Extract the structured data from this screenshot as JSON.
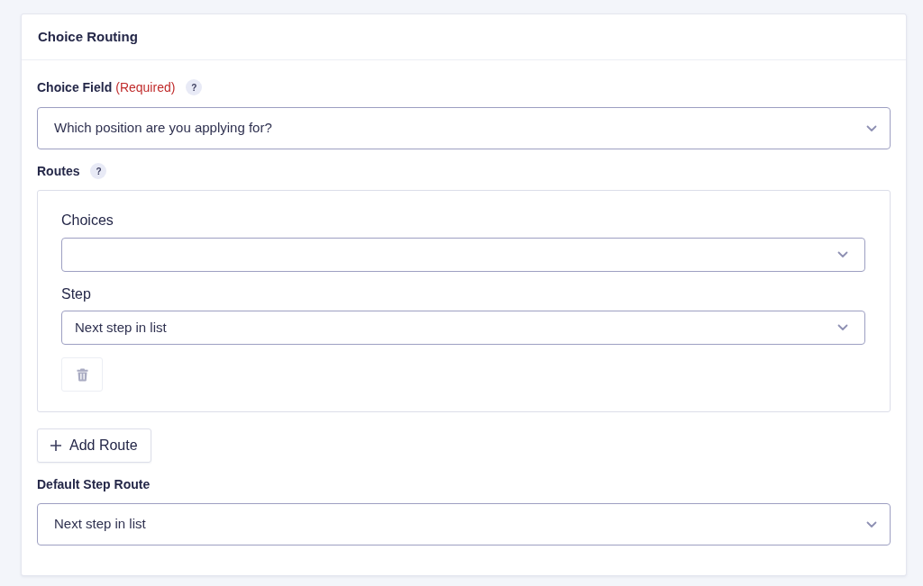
{
  "panel": {
    "title": "Choice Routing"
  },
  "choice_field": {
    "label": "Choice Field",
    "required_note": "(Required)",
    "help": "?",
    "value": "Which position are you applying for?"
  },
  "routes": {
    "label": "Routes",
    "help": "?",
    "items": [
      {
        "choices": {
          "label": "Choices"
        },
        "step": {
          "label": "Step",
          "value": "Next step in list"
        }
      }
    ]
  },
  "add_route_button": {
    "label": "Add Route"
  },
  "default_step_route": {
    "label": "Default Step Route",
    "value": "Next step in list"
  }
}
